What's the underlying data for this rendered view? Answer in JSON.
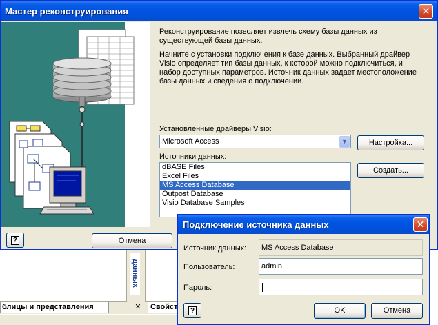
{
  "wizard": {
    "title": "Мастер реконструирования",
    "intro_1": "Реконструирование позволяет извлечь схему базы данных из существующей базы данных.",
    "intro_2": "Начните с установки подключения к базе данных.  Выбранный драйвер Visio определяет тип базы данных, к которой можно подключиться, и набор доступных параметров. Источник данных задает местоположение базы данных и сведения о подключении.",
    "drivers_label": "Установленные драйверы Visio:",
    "driver_selected": "Microsoft Access",
    "setup_button": "Настройка...",
    "sources_label": "Источники данных:",
    "sources": [
      {
        "label": "dBASE Files",
        "selected": false
      },
      {
        "label": "Excel Files",
        "selected": false
      },
      {
        "label": "MS Access Database",
        "selected": true
      },
      {
        "label": "Outpost Database",
        "selected": false
      },
      {
        "label": "Visio Database Samples",
        "selected": false
      }
    ],
    "create_button": "Создать...",
    "cancel_button": "Отмена",
    "help_glyph": "?",
    "close_glyph": "✕"
  },
  "background": {
    "tab_tables_views": "блицы и представления",
    "tab_close_glyph": "✕",
    "tab_props": "Свойст",
    "side_label": "данных"
  },
  "connect_dialog": {
    "title": "Подключение источника данных",
    "source_label": "Источник данных:",
    "source_value": "MS Access Database",
    "user_label": "Пользователь:",
    "user_value": "admin",
    "password_label": "Пароль:",
    "password_value": "",
    "ok_button": "OK",
    "cancel_button": "Отмена",
    "help_glyph": "?",
    "close_glyph": "✕"
  },
  "colors": {
    "titlebar": "#0054e3",
    "teal_panel": "#317f7b",
    "selection": "#316ac5",
    "close_button": "#d3482a"
  }
}
